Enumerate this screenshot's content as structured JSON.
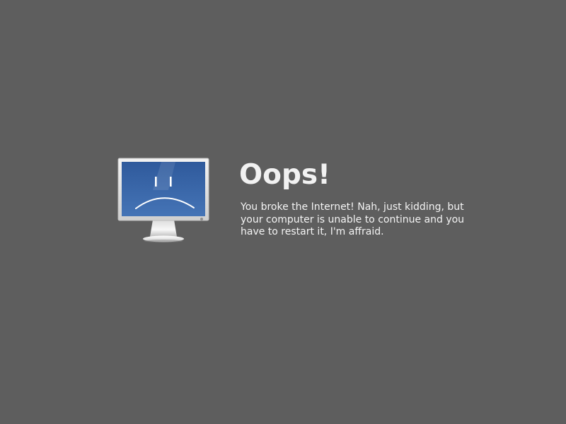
{
  "error": {
    "title": "Oops!",
    "message": "You broke the Internet! Nah, just kidding, but your computer is unable to continue and you have to restart it, I'm affraid.",
    "illustration_icon": "sad-monitor-icon"
  },
  "colors": {
    "background": "#5e5e5e",
    "text": "#f2f2f2",
    "screen_blue": "#3a66a8"
  }
}
